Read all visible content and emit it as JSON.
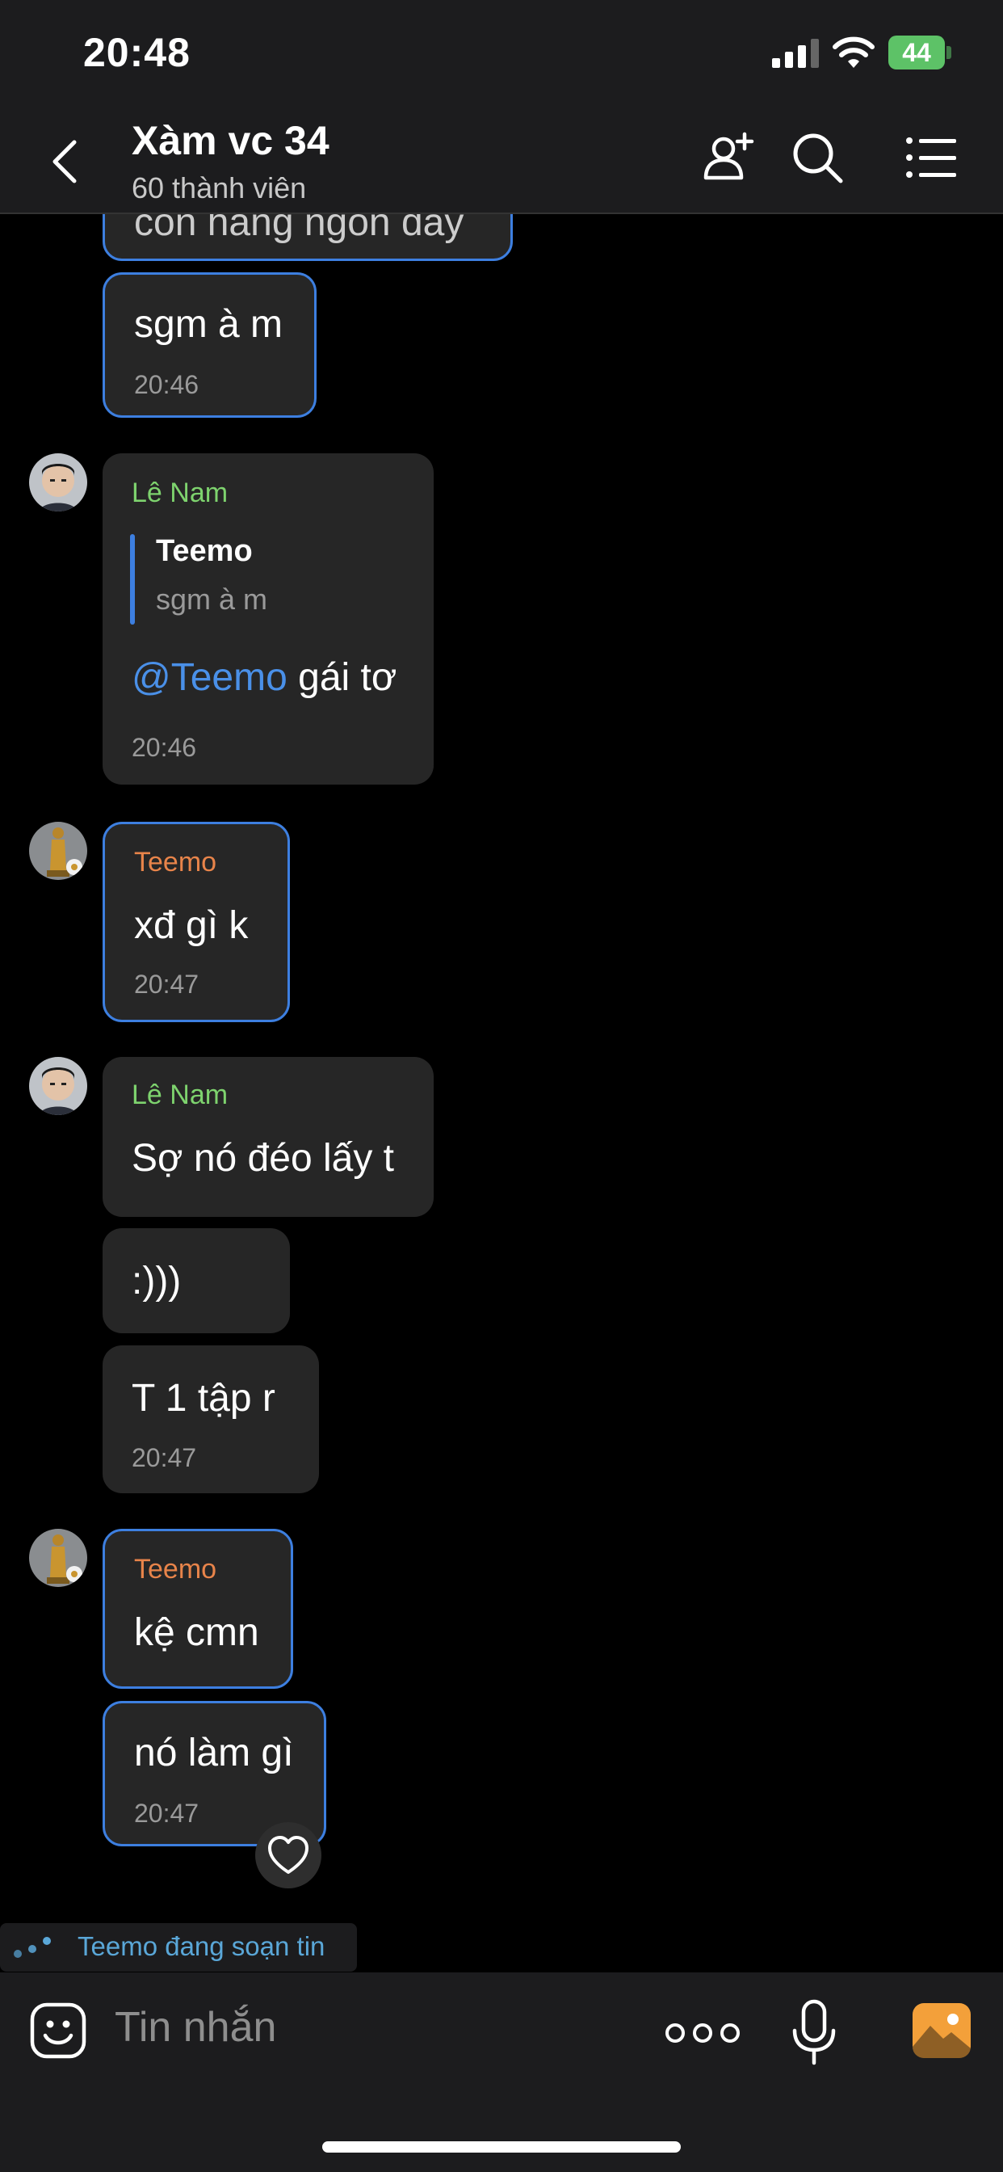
{
  "status": {
    "time": "20:48",
    "battery": "44"
  },
  "header": {
    "title": "Xàm vc 34",
    "subtitle": "60 thành viên"
  },
  "messages": {
    "m0": {
      "text": "còn hàng ngon đây"
    },
    "m1": {
      "text": "sgm à m",
      "time": "20:46"
    },
    "m2": {
      "sender": "Lê Nam",
      "quote_name": "Teemo",
      "quote_text": "sgm à m",
      "mention": "@Teemo",
      "text": " gái tơ",
      "time": "20:46"
    },
    "m3": {
      "sender": "Teemo",
      "text": "xđ gì k",
      "time": "20:47"
    },
    "m4": {
      "sender": "Lê Nam",
      "text": "Sợ nó đéo lấy t"
    },
    "m5": {
      "text": ":)))"
    },
    "m6": {
      "text": "T 1 tập  r",
      "time": "20:47"
    },
    "m7": {
      "sender": "Teemo",
      "text": "kệ cmn"
    },
    "m8": {
      "text": "nó làm gì",
      "time": "20:47"
    }
  },
  "typing": {
    "text": "Teemo đang soạn tin"
  },
  "input": {
    "placeholder": "Tin nhắn"
  },
  "colors": {
    "accent": "#3d7fe0",
    "name_green": "#7ed36e",
    "name_orange": "#e8844a",
    "bubble": "#262626"
  }
}
